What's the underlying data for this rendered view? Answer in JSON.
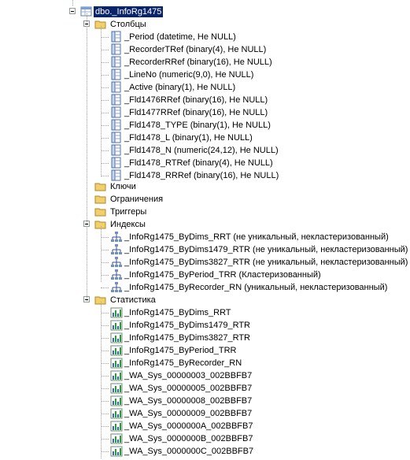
{
  "tree": {
    "table": {
      "label": "dbo._InfoRg1475",
      "icon": "table-icon",
      "selected": true
    },
    "columns_folder": {
      "label": "Столбцы",
      "icon": "folder-icon"
    },
    "columns": [
      "_Period (datetime, Не NULL)",
      "_RecorderTRef (binary(4), Не NULL)",
      "_RecorderRRef (binary(16), Не NULL)",
      "_LineNo (numeric(9,0), Не NULL)",
      "_Active (binary(1), Не NULL)",
      "_Fld1476RRef (binary(16), Не NULL)",
      "_Fld1477RRef (binary(16), Не NULL)",
      "_Fld1478_TYPE (binary(1), Не NULL)",
      "_Fld1478_L (binary(1), Не NULL)",
      "_Fld1478_N (numeric(24,12), Не NULL)",
      "_Fld1478_RTRef (binary(4), Не NULL)",
      "_Fld1478_RRRef (binary(16), Не NULL)"
    ],
    "keys_folder": {
      "label": "Ключи",
      "icon": "folder-icon"
    },
    "constraints_folder": {
      "label": "Ограничения",
      "icon": "folder-icon"
    },
    "triggers_folder": {
      "label": "Триггеры",
      "icon": "folder-icon"
    },
    "indexes_folder": {
      "label": "Индексы",
      "icon": "folder-icon"
    },
    "indexes": [
      "_InfoRg1475_ByDims_RRT (не уникальный, некластеризованный)",
      "_InfoRg1475_ByDims1479_RTR (не уникальный, некластеризованный)",
      "_InfoRg1475_ByDims3827_RTR (не уникальный, некластеризованный)",
      "_InfoRg1475_ByPeriod_TRR (Кластеризованный)",
      "_InfoRg1475_ByRecorder_RN (уникальный, некластеризованный)"
    ],
    "statistics_folder": {
      "label": "Статистика",
      "icon": "folder-icon"
    },
    "statistics": [
      "_InfoRg1475_ByDims_RRT",
      "_InfoRg1475_ByDims1479_RTR",
      "_InfoRg1475_ByDims3827_RTR",
      "_InfoRg1475_ByPeriod_TRR",
      "_InfoRg1475_ByRecorder_RN",
      "_WA_Sys_00000003_002BBFB7",
      "_WA_Sys_00000005_002BBFB7",
      "_WA_Sys_00000008_002BBFB7",
      "_WA_Sys_00000009_002BBFB7",
      "_WA_Sys_0000000A_002BBFB7",
      "_WA_Sys_0000000B_002BBFB7",
      "_WA_Sys_0000000C_002BBFB7"
    ],
    "icons": {
      "column": "column-icon",
      "index": "index-icon",
      "statistic": "statistics-icon",
      "collapse": "collapse-toggle-icon"
    },
    "colors": {
      "selection": "#0a246a",
      "folder": "#f2cf6b",
      "tree_lines": "#a0a0a0"
    }
  }
}
